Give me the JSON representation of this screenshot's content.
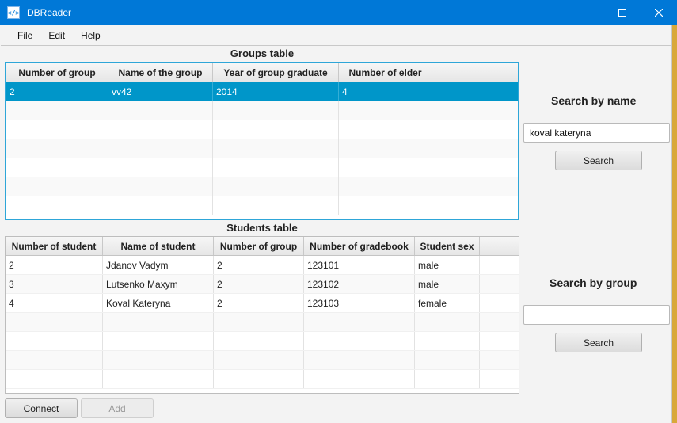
{
  "window": {
    "title": "DBReader",
    "icon": "code-icon",
    "icon_glyph": "</>"
  },
  "menu": {
    "items": [
      "File",
      "Edit",
      "Help"
    ]
  },
  "groups_table": {
    "title": "Groups table",
    "columns": [
      "Number of group",
      "Name of the group",
      "Year of group graduate",
      "Number of elder",
      ""
    ],
    "rows": [
      [
        "2",
        "vv42",
        "2014",
        "4",
        ""
      ]
    ],
    "selected_row": 0
  },
  "students_table": {
    "title": "Students table",
    "columns": [
      "Number of student",
      "Name of student",
      "Number of group",
      "Number of gradebook",
      "Student sex",
      ""
    ],
    "rows": [
      [
        "2",
        "Jdanov Vadym",
        "2",
        "123101",
        "male",
        ""
      ],
      [
        "3",
        "Lutsenko Maxym",
        "2",
        "123102",
        "male",
        ""
      ],
      [
        "4",
        "Koval Kateryna",
        "2",
        "123103",
        "female",
        ""
      ]
    ]
  },
  "search_by_name": {
    "heading": "Search by name",
    "value": "koval kateryna",
    "button": "Search"
  },
  "search_by_group": {
    "heading": "Search by group",
    "value": "",
    "button": "Search"
  },
  "buttons": {
    "connect": "Connect",
    "add": "Add"
  }
}
